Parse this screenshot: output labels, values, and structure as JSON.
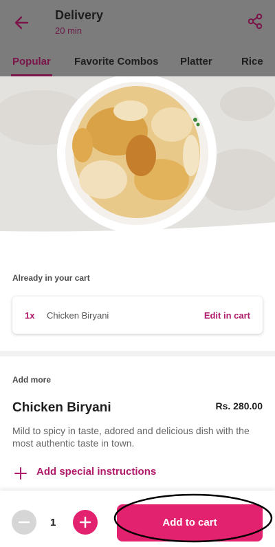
{
  "header": {
    "title": "Delivery",
    "subtitle": "20 min",
    "back_icon": "arrow-left-icon",
    "share_icon": "share-icon"
  },
  "tabs": [
    {
      "label": "Popular",
      "active": true
    },
    {
      "label": "Favorite Combos"
    },
    {
      "label": "Platter"
    },
    {
      "label": "Rice"
    }
  ],
  "cart": {
    "label": "Already in your cart",
    "quantity": "1x",
    "item": "Chicken Biryani",
    "edit_label": "Edit in cart"
  },
  "add_more": {
    "label": "Add more",
    "item_name": "Chicken Biryani",
    "price": "Rs. 280.00",
    "description": "Mild to spicy in taste, adored and delicious dish with the most authentic taste in town.",
    "special_instructions": "Add special instructions"
  },
  "footer": {
    "quantity": "1",
    "add_to_cart": "Add to cart"
  },
  "colors": {
    "accent": "#e2216f",
    "accent_text": "#b01a6a"
  }
}
